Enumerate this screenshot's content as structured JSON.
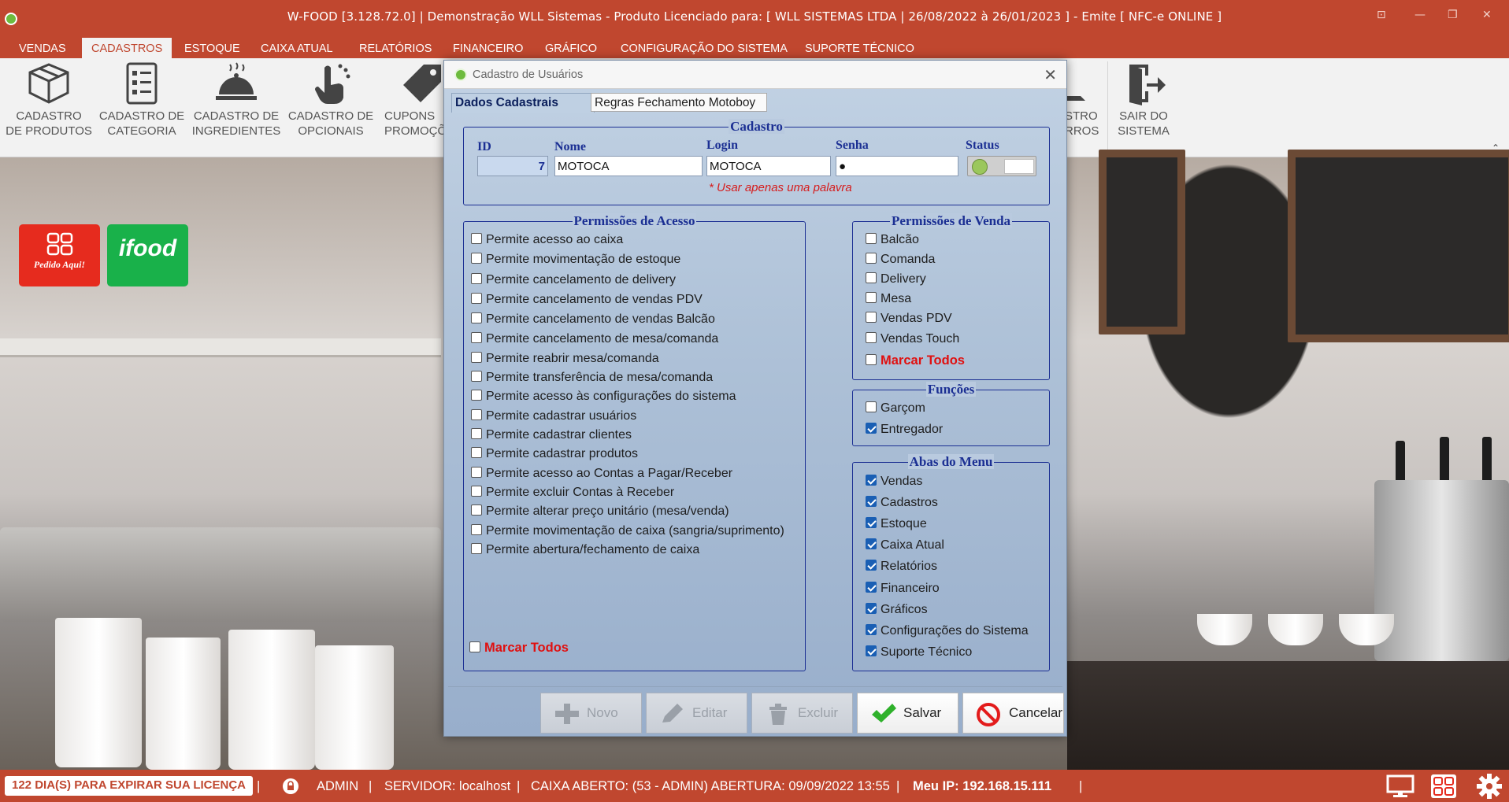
{
  "window": {
    "title": "W-FOOD [3.128.72.0] | Demonstração WLL Sistemas - Produto Licenciado para:  [ WLL SISTEMAS LTDA | 26/08/2022 à 26/01/2023 ]  - Emite [ NFC-e ONLINE ]"
  },
  "menu": {
    "tabs": [
      "VENDAS",
      "CADASTROS",
      "ESTOQUE",
      "CAIXA ATUAL",
      "RELATÓRIOS",
      "FINANCEIRO",
      "GRÁFICO",
      "CONFIGURAÇÃO DO SISTEMA",
      "SUPORTE TÉCNICO"
    ],
    "active": "CADASTROS"
  },
  "ribbon": {
    "buttons": [
      {
        "line1": "CADASTRO",
        "line2": "DE PRODUTOS"
      },
      {
        "line1": "CADASTRO DE",
        "line2": "CATEGORIA"
      },
      {
        "line1": "CADASTRO DE",
        "line2": "INGREDIENTES"
      },
      {
        "line1": "CADASTRO DE",
        "line2": "OPCIONAIS"
      },
      {
        "line1": "CUPONS",
        "line2": "PROMOÇÕ"
      },
      {
        "line1": "STRO",
        "line2": "RROS"
      },
      {
        "line1": "SAIR DO",
        "line2": "SISTEMA"
      }
    ]
  },
  "integrations": {
    "pedido_aqui": "Pedido Aqui!",
    "ifood": "ifood"
  },
  "dialog": {
    "title": "Cadastro de Usuários",
    "tabs": [
      "Dados Cadastrais",
      "Regras Fechamento Motoboy"
    ],
    "cadastro": {
      "legend": "Cadastro",
      "id_label": "ID",
      "id_value": "7",
      "nome_label": "Nome",
      "nome_value": "MOTOCA",
      "login_label": "Login",
      "login_value": "MOTOCA",
      "senha_label": "Senha",
      "senha_value": "●",
      "status_label": "Status",
      "hint": "* Usar apenas uma palavra"
    },
    "permissoes_acesso": {
      "legend": "Permissões de Acesso",
      "items": [
        {
          "label": "Permite acesso ao caixa",
          "checked": false
        },
        {
          "label": "Permite movimentação de estoque",
          "checked": false
        },
        {
          "label": "Permite cancelamento de delivery",
          "checked": false
        },
        {
          "label": "Permite cancelamento de vendas PDV",
          "checked": false
        },
        {
          "label": "Permite cancelamento de vendas Balcão",
          "checked": false
        },
        {
          "label": "Permite cancelamento de mesa/comanda",
          "checked": false
        },
        {
          "label": "Permite reabrir mesa/comanda",
          "checked": false
        },
        {
          "label": "Permite transferência de mesa/comanda",
          "checked": false
        },
        {
          "label": "Permite acesso às configurações do sistema",
          "checked": false
        },
        {
          "label": "Permite cadastrar usuários",
          "checked": false
        },
        {
          "label": "Permite cadastrar clientes",
          "checked": false
        },
        {
          "label": "Permite cadastrar produtos",
          "checked": false
        },
        {
          "label": "Permite acesso ao Contas a Pagar/Receber",
          "checked": false
        },
        {
          "label": "Permite excluir Contas à Receber",
          "checked": false
        },
        {
          "label": "Permite alterar preço unitário (mesa/venda)",
          "checked": false
        },
        {
          "label": "Permite movimentação de caixa (sangria/suprimento)",
          "checked": false
        },
        {
          "label": "Permite abertura/fechamento de caixa",
          "checked": false
        }
      ],
      "mark_all": "Marcar Todos"
    },
    "permissoes_venda": {
      "legend": "Permissões de Venda",
      "items": [
        {
          "label": "Balcão",
          "checked": false
        },
        {
          "label": "Comanda",
          "checked": false
        },
        {
          "label": "Delivery",
          "checked": false
        },
        {
          "label": "Mesa",
          "checked": false
        },
        {
          "label": "Vendas PDV",
          "checked": false
        },
        {
          "label": "Vendas Touch",
          "checked": false
        }
      ],
      "mark_all": "Marcar Todos"
    },
    "funcoes": {
      "legend": "Funções",
      "items": [
        {
          "label": "Garçom",
          "checked": false
        },
        {
          "label": "Entregador",
          "checked": true
        }
      ]
    },
    "abas_menu": {
      "legend": "Abas do Menu",
      "items": [
        {
          "label": "Vendas",
          "checked": true
        },
        {
          "label": "Cadastros",
          "checked": true
        },
        {
          "label": "Estoque",
          "checked": true
        },
        {
          "label": "Caixa Atual",
          "checked": true
        },
        {
          "label": "Relatórios",
          "checked": true
        },
        {
          "label": "Financeiro",
          "checked": true
        },
        {
          "label": "Gráficos",
          "checked": true
        },
        {
          "label": "Configurações do Sistema",
          "checked": true
        },
        {
          "label": "Suporte Técnico",
          "checked": true
        }
      ]
    },
    "buttons": {
      "novo": "Novo",
      "editar": "Editar",
      "excluir": "Excluir",
      "salvar": "Salvar",
      "cancelar": "Cancelar"
    }
  },
  "statusbar": {
    "license": "122 DIA(S) PARA EXPIRAR SUA LICENÇA",
    "user": "ADMIN",
    "server": "SERVIDOR: localhost",
    "caixa": "CAIXA ABERTO: (53 - ADMIN) ABERTURA: 09/09/2022 13:55",
    "ip": "Meu IP: 192.168.15.111"
  },
  "colors": {
    "brand": "#c0472f",
    "legend_blue": "#1b2f93",
    "mark_all_red": "#e01010",
    "checkbox_blue": "#1a5fb4"
  }
}
